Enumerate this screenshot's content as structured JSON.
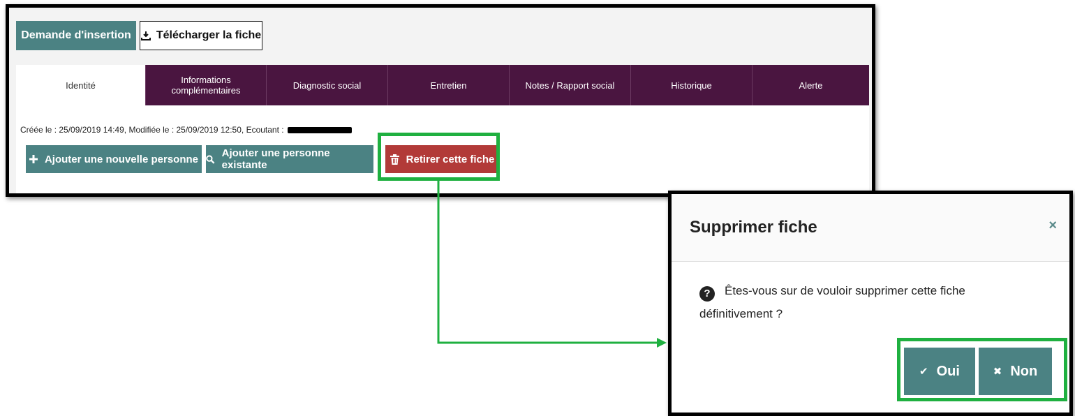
{
  "toolbar": {
    "demande_label": "Demande d'insertion",
    "telecharger_label": "Télécharger la fiche"
  },
  "tabs": [
    {
      "label": "Identité",
      "active": true
    },
    {
      "label": "Informations complémentaires",
      "active": false
    },
    {
      "label": "Diagnostic social",
      "active": false
    },
    {
      "label": "Entretien",
      "active": false
    },
    {
      "label": "Notes / Rapport social",
      "active": false
    },
    {
      "label": "Historique",
      "active": false
    },
    {
      "label": "Alerte",
      "active": false
    }
  ],
  "meta": {
    "text": "Créée le : 25/09/2019 14:49, Modifiée le : 25/09/2019 12:50, Ecoutant :"
  },
  "actions": {
    "add_new": "Ajouter une nouvelle personne",
    "add_existing": "Ajouter une personne existante",
    "remove": "Retirer cette fiche"
  },
  "dialog": {
    "title": "Supprimer fiche",
    "close": "×",
    "message": "Êtes-vous sur de vouloir supprimer cette fiche définitivement ?",
    "oui": "Oui",
    "non": "Non"
  },
  "colors": {
    "teal": "#4b8283",
    "tab_bg": "#4a1540",
    "danger": "#b23a38",
    "highlight": "#1fb040"
  }
}
